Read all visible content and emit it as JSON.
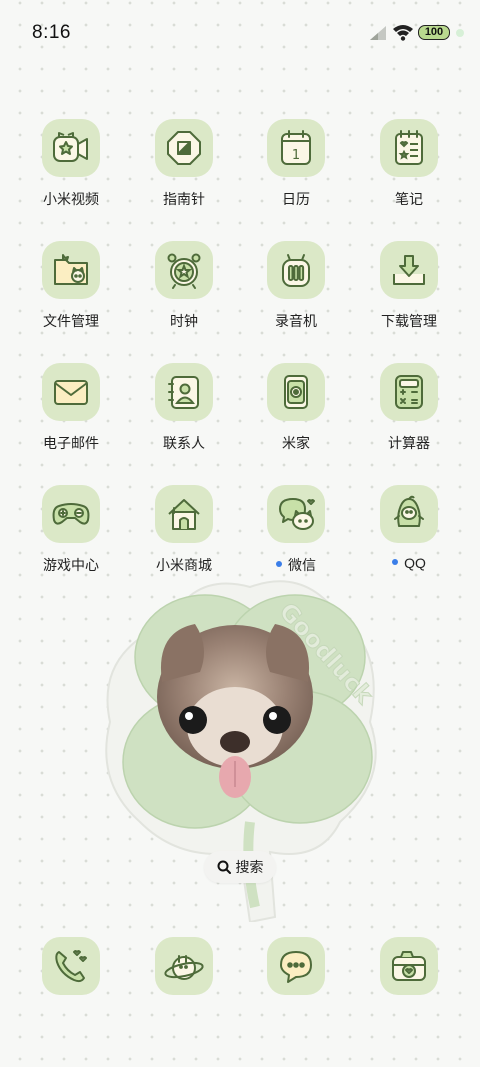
{
  "status": {
    "time": "8:16",
    "battery": "100"
  },
  "apps": [
    {
      "label": "小米视频",
      "icon": "video-camera-icon"
    },
    {
      "label": "指南针",
      "icon": "compass-icon"
    },
    {
      "label": "日历",
      "icon": "calendar-icon",
      "badge_text": "1"
    },
    {
      "label": "笔记",
      "icon": "notes-icon"
    },
    {
      "label": "文件管理",
      "icon": "folder-icon"
    },
    {
      "label": "时钟",
      "icon": "alarm-clock-icon"
    },
    {
      "label": "录音机",
      "icon": "recorder-icon"
    },
    {
      "label": "下载管理",
      "icon": "download-icon"
    },
    {
      "label": "电子邮件",
      "icon": "envelope-icon"
    },
    {
      "label": "联系人",
      "icon": "contacts-icon"
    },
    {
      "label": "米家",
      "icon": "mijia-icon"
    },
    {
      "label": "计算器",
      "icon": "calculator-icon"
    },
    {
      "label": "游戏中心",
      "icon": "gamepad-icon"
    },
    {
      "label": "小米商城",
      "icon": "house-icon"
    },
    {
      "label": "微信",
      "icon": "wechat-icon",
      "new_indicator": true
    },
    {
      "label": "QQ",
      "icon": "qq-penguin-icon",
      "new_indicator": true
    }
  ],
  "widget": {
    "lettering": "Goodluck"
  },
  "search": {
    "label": "搜索"
  },
  "dock": [
    {
      "icon": "phone-icon"
    },
    {
      "icon": "browser-planet-icon"
    },
    {
      "icon": "message-bubble-icon"
    },
    {
      "icon": "camera-icon"
    }
  ],
  "colors": {
    "tile": "#dbe8c7",
    "stroke": "#4e6b3a",
    "notification_dot": "#3b7ee8",
    "battery_fill": "#b9d98f"
  }
}
